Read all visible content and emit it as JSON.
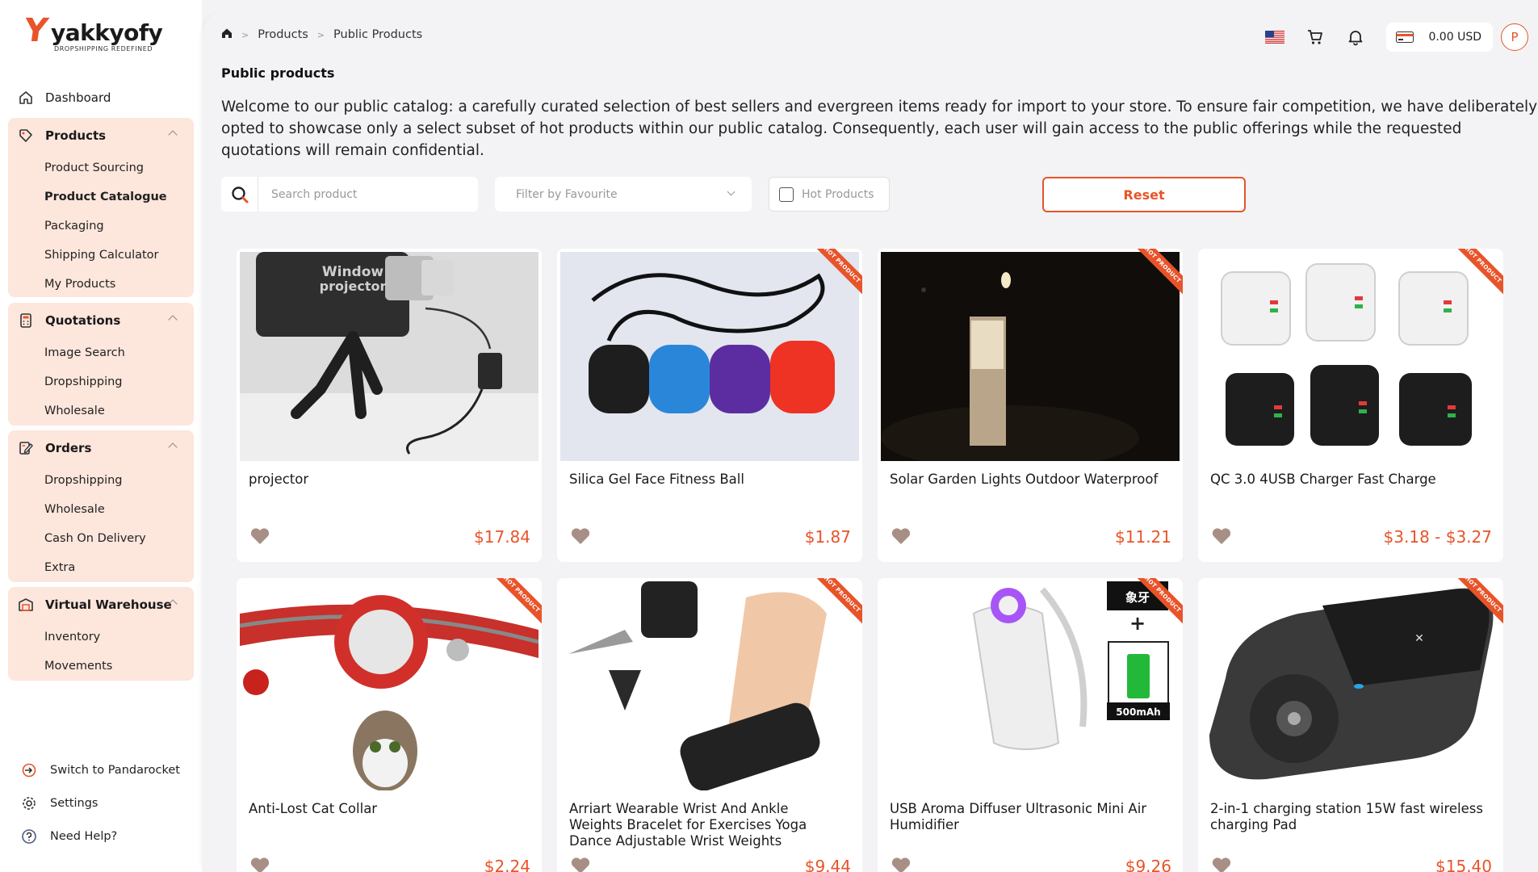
{
  "brand": {
    "name": "yakkyofy",
    "tagline": "DROPSHIPPING REDEFINED",
    "accent": "#e8542a",
    "sidebar_highlight": "#fde6dc"
  },
  "sidebar": {
    "dashboard": "Dashboard",
    "groups": [
      {
        "label": "Products",
        "icon": "tag-icon",
        "items": [
          "Product Sourcing",
          "Product Catalogue",
          "Packaging",
          "Shipping Calculator",
          "My Products"
        ],
        "active": "Product Catalogue"
      },
      {
        "label": "Quotations",
        "icon": "calculator-icon",
        "items": [
          "Image Search",
          "Dropshipping",
          "Wholesale"
        ]
      },
      {
        "label": "Orders",
        "icon": "edit-icon",
        "items": [
          "Dropshipping",
          "Wholesale",
          "Cash On Delivery",
          "Extra"
        ]
      },
      {
        "label": "Virtual Warehouse",
        "icon": "warehouse-icon",
        "items": [
          "Inventory",
          "Movements"
        ]
      }
    ],
    "footer": [
      "Switch to Pandarocket",
      "Settings",
      "Need Help?"
    ]
  },
  "breadcrumb": [
    "Products",
    "Public Products"
  ],
  "topbar": {
    "balance": "0.00 USD",
    "avatar_initial": "P"
  },
  "page": {
    "title": "Public products",
    "intro": "Welcome to our public catalog: a carefully curated selection of best sellers and evergreen items ready for import to your store. To ensure fair competition, we have deliberately opted to showcase only a select subset of hot products within our public catalog. Consequently, each user will gain access to the public offerings while the requested quotations will remain confidential."
  },
  "filters": {
    "search_placeholder": "Search product",
    "favourite_placeholder": "Filter by Favourite",
    "hot_label": "Hot Products",
    "reset_label": "Reset"
  },
  "ribbon_text": "HOT PRODUCT",
  "products": [
    {
      "name": "projector",
      "price": "$17.84",
      "hot": false
    },
    {
      "name": "Silica Gel Face Fitness Ball",
      "price": "$1.87",
      "hot": true
    },
    {
      "name": "Solar Garden Lights Outdoor Waterproof",
      "price": "$11.21",
      "hot": true
    },
    {
      "name": "QC 3.0 4USB Charger Fast Charge",
      "price": "$3.18 - $3.27",
      "hot": true
    },
    {
      "name": "Anti-Lost Cat Collar",
      "price": "$2.24",
      "hot": true
    },
    {
      "name": "Arriart Wearable Wrist And Ankle Weights Bracelet for Exercises Yoga Dance Adjustable Wrist Weights",
      "price": "$9.44",
      "hot": true
    },
    {
      "name": "USB Aroma Diffuser Ultrasonic Mini Air Humidifier",
      "price": "$9.26",
      "hot": true
    },
    {
      "name": "2-in-1 charging station 15W fast wireless charging Pad",
      "price": "$15.40",
      "hot": true
    }
  ],
  "image_texts": {
    "projector_label_1": "Window",
    "projector_label_2": "projector",
    "battery_label": "500mAh",
    "diffuser_tag": "象牙"
  }
}
